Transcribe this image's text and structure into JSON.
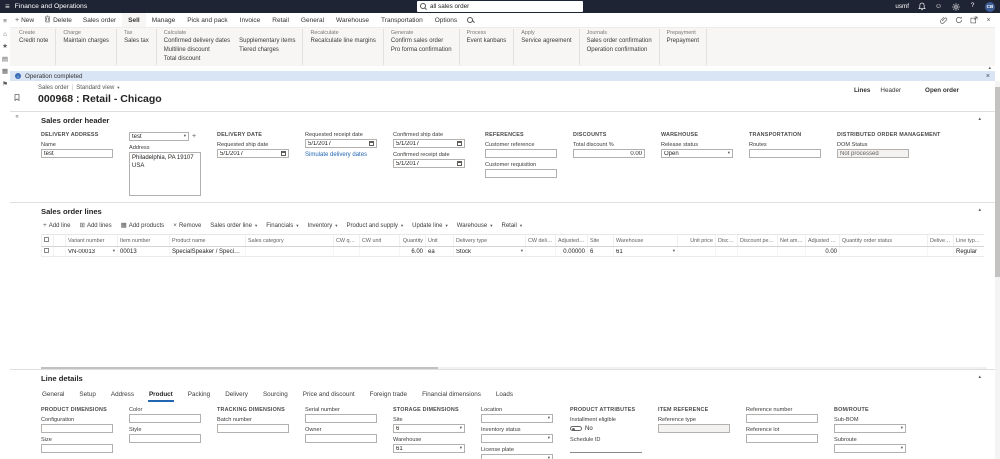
{
  "topbar": {
    "app_title": "Finance and Operations",
    "search_text": "all sales order",
    "company": "usmf",
    "avatar_initials": "CB"
  },
  "action_pane": {
    "new_label": "New",
    "delete_label": "Delete",
    "tabs": [
      {
        "label": "Sales order"
      },
      {
        "label": "Sell"
      },
      {
        "label": "Manage"
      },
      {
        "label": "Pick and pack"
      },
      {
        "label": "Invoice"
      },
      {
        "label": "Retail"
      },
      {
        "label": "General"
      },
      {
        "label": "Warehouse"
      },
      {
        "label": "Transportation"
      },
      {
        "label": "Options"
      }
    ]
  },
  "ribbon": {
    "groups": [
      {
        "title": "Create",
        "cols": [
          [
            "Credit note"
          ]
        ]
      },
      {
        "title": "Charge",
        "cols": [
          [
            "Maintain charges"
          ]
        ]
      },
      {
        "title": "Tax",
        "cols": [
          [
            "Sales tax"
          ]
        ]
      },
      {
        "title": "Calculate",
        "cols": [
          [
            "Confirmed delivery dates",
            "Multiline discount",
            "Total discount"
          ],
          [
            "Supplementary items",
            "Tiered charges"
          ]
        ]
      },
      {
        "title": "Recalculate",
        "cols": [
          [
            "Recalculate line margins"
          ]
        ]
      },
      {
        "title": "Generate",
        "cols": [
          [
            "Confirm sales order",
            "Pro forma confirmation"
          ]
        ]
      },
      {
        "title": "Process",
        "cols": [
          [
            "Event kanbans"
          ]
        ]
      },
      {
        "title": "Apply",
        "cols": [
          [
            "Service agreement"
          ]
        ]
      },
      {
        "title": "Journals",
        "cols": [
          [
            "Sales order confirmation",
            "Operation confirmation"
          ]
        ]
      },
      {
        "title": "Prepayment",
        "cols": [
          [
            "Prepayment"
          ]
        ]
      }
    ]
  },
  "notification": {
    "message": "Operation completed"
  },
  "page": {
    "breadcrumb": "Sales order",
    "view_name": "Standard view",
    "title": "000968 : Retail - Chicago",
    "lines_link": "Lines",
    "header_link": "Header",
    "status": "Open order"
  },
  "order_header": {
    "section_title": "Sales order header",
    "delivery_address": {
      "title": "DELIVERY ADDRESS",
      "name_label": "Name",
      "name_value": "test",
      "address_selector": "test",
      "address_label": "Address",
      "address_value": "Philadelphia, PA 19107\nUSA"
    },
    "delivery_date": {
      "title": "DELIVERY DATE",
      "requested_ship_label": "Requested ship date",
      "requested_ship": "5/1/2017",
      "requested_receipt_label": "Requested receipt date",
      "requested_receipt": "5/1/2017",
      "simulate_link": "Simulate delivery dates",
      "confirmed_ship_label": "Confirmed ship date",
      "confirmed_ship": "5/1/2017",
      "confirmed_receipt_label": "Confirmed receipt date",
      "confirmed_receipt": "5/1/2017"
    },
    "references": {
      "title": "REFERENCES",
      "customer_reference_label": "Customer reference",
      "customer_reference": "",
      "customer_requisition_label": "Customer requisition",
      "customer_requisition": ""
    },
    "discounts": {
      "title": "DISCOUNTS",
      "total_discount_label": "Total discount %",
      "total_discount": "0.00"
    },
    "warehouse": {
      "title": "WAREHOUSE",
      "release_status_label": "Release status",
      "release_status": "Open"
    },
    "transportation": {
      "title": "TRANSPORTATION",
      "routes_label": "Routes",
      "routes": ""
    },
    "dom": {
      "title": "DISTRIBUTED ORDER MANAGEMENT",
      "status_label": "DOM Status",
      "status": "Not processed"
    }
  },
  "order_lines": {
    "section_title": "Sales order lines",
    "toolbar": {
      "add_line": "Add line",
      "add_lines": "Add lines",
      "add_products": "Add products",
      "remove": "Remove",
      "menus": [
        "Sales order line",
        "Financials",
        "Inventory",
        "Product and supply",
        "Update line",
        "Warehouse",
        "Retail"
      ]
    },
    "grid": {
      "columns": [
        "Variant number",
        "Item number",
        "Product name",
        "Sales category",
        "CW quantity",
        "CW unit",
        "Quantity",
        "Unit",
        "Delivery type",
        "CW deliver now",
        "Adjusted unit...",
        "Site",
        "Warehouse",
        "Unit price",
        "Discount",
        "Discount perce...",
        "Net amount",
        "Adjusted net a...",
        "Quantity order status",
        "Deliver rem...",
        "Line typ..."
      ],
      "row": {
        "variant_number": "VN-00013",
        "item_number": "00013",
        "product_name": "SpecialSpeaker / SpecialSpeaker",
        "sales_category": "",
        "cw_quantity": "",
        "cw_unit": "",
        "quantity": "6.00",
        "unit": "ea",
        "delivery_type": "Stock",
        "cw_deliver_now": "",
        "adjusted_unit": "0.00000",
        "site": "6",
        "warehouse": "61",
        "unit_price": "",
        "discount": "",
        "discount_percent": "",
        "net_amount": "",
        "adjusted_net": "0.00",
        "quantity_order_status": "",
        "deliver_rem": "",
        "line_type": "Regular"
      }
    }
  },
  "line_details": {
    "section_title": "Line details",
    "tabs": [
      {
        "label": "General"
      },
      {
        "label": "Setup"
      },
      {
        "label": "Address"
      },
      {
        "label": "Product"
      },
      {
        "label": "Packing"
      },
      {
        "label": "Delivery"
      },
      {
        "label": "Sourcing"
      },
      {
        "label": "Price and discount"
      },
      {
        "label": "Foreign trade"
      },
      {
        "label": "Financial dimensions"
      },
      {
        "label": "Loads"
      }
    ],
    "product_dimensions": {
      "title": "PRODUCT DIMENSIONS",
      "configuration_label": "Configuration",
      "configuration": "",
      "size_label": "Size",
      "size": "",
      "color_label": "Color",
      "color": "",
      "style_label": "Style",
      "style": ""
    },
    "tracking_dimensions": {
      "title": "TRACKING DIMENSIONS",
      "batch_number_label": "Batch number",
      "batch_number": "",
      "serial_number_label": "Serial number",
      "serial_number": "",
      "owner_label": "Owner",
      "owner": ""
    },
    "storage_dimensions": {
      "title": "STORAGE DIMENSIONS",
      "site_label": "Site",
      "site": "6",
      "warehouse_label": "Warehouse",
      "warehouse": "61",
      "location_label": "Location",
      "location": "",
      "inventory_status_label": "Inventory status",
      "inventory_status": "",
      "license_plate_label": "License plate",
      "license_plate": ""
    },
    "product_attributes": {
      "title": "PRODUCT ATTRIBUTES",
      "installment_label": "Installment eligible",
      "installment_value": "No",
      "schedule_id_label": "Schedule ID",
      "schedule_id": ""
    },
    "item_reference": {
      "title": "ITEM REFERENCE",
      "reference_type_label": "Reference type",
      "reference_type": "",
      "reference_number_label": "Reference number",
      "reference_number": "",
      "reference_lot_label": "Reference lot",
      "reference_lot": ""
    },
    "bom_route": {
      "title": "BOM/ROUTE",
      "sub_bom_label": "Sub-BOM",
      "sub_bom": "",
      "subroute_label": "Subroute",
      "subroute": ""
    }
  }
}
